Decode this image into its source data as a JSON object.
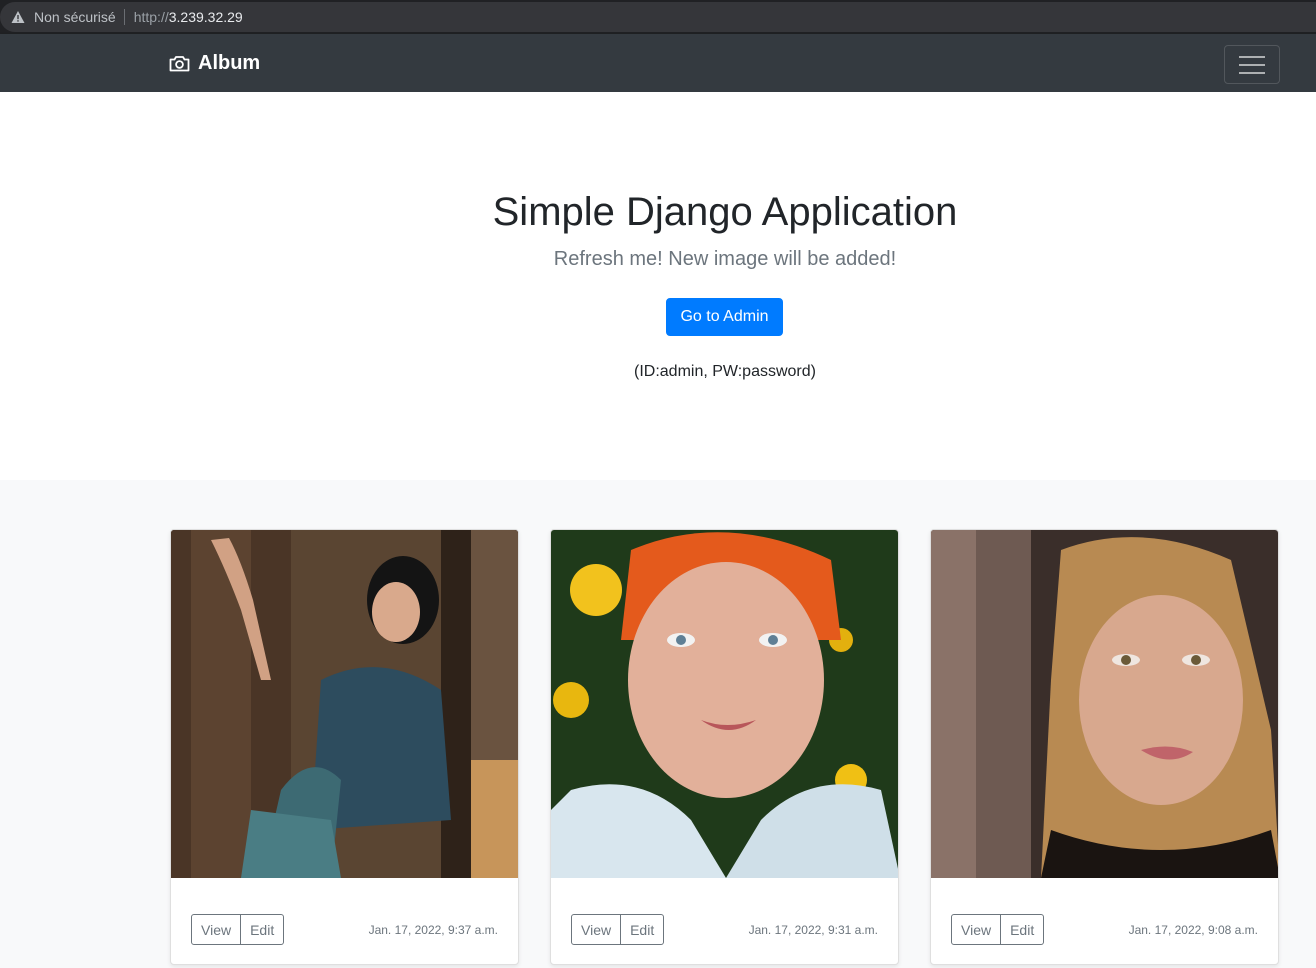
{
  "browser": {
    "security_label": "Non sécurisé",
    "url_scheme": "http://",
    "url_host": "3.239.32.29"
  },
  "navbar": {
    "brand": "Album",
    "brand_icon": "camera-icon",
    "toggler_icon": "hamburger-icon"
  },
  "jumbotron": {
    "title": "Simple Django Application",
    "lead": "Refresh me! New image will be added!",
    "admin_button": "Go to Admin",
    "credentials": "(ID:admin, PW:password)"
  },
  "cards": [
    {
      "view_label": "View",
      "edit_label": "Edit",
      "timestamp": "Jan. 17, 2022, 9:37 a.m."
    },
    {
      "view_label": "View",
      "edit_label": "Edit",
      "timestamp": "Jan. 17, 2022, 9:31 a.m."
    },
    {
      "view_label": "View",
      "edit_label": "Edit",
      "timestamp": "Jan. 17, 2022, 9:08 a.m."
    }
  ],
  "colors": {
    "navbar_bg": "#343a40",
    "primary": "#007bff",
    "album_bg": "#f8f9fa",
    "muted": "#6c757d"
  }
}
